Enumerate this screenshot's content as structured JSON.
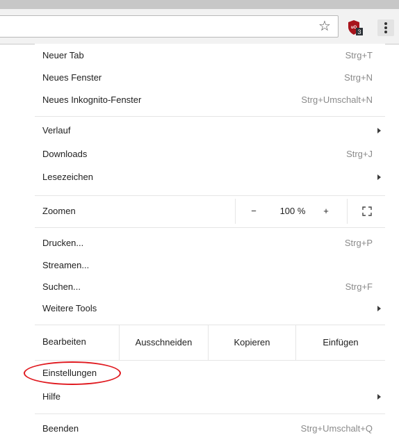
{
  "toolbar": {
    "bookmark_icon": "star-icon",
    "extension_icon": "ublock-origin-icon",
    "extension_badge": "3",
    "menu_icon": "kebab-menu-icon"
  },
  "menu": {
    "new_tab": {
      "label": "Neuer Tab",
      "shortcut": "Strg+T"
    },
    "new_window": {
      "label": "Neues Fenster",
      "shortcut": "Strg+N"
    },
    "incognito": {
      "label": "Neues Inkognito-Fenster",
      "shortcut": "Strg+Umschalt+N"
    },
    "history": {
      "label": "Verlauf"
    },
    "downloads": {
      "label": "Downloads",
      "shortcut": "Strg+J"
    },
    "bookmarks": {
      "label": "Lesezeichen"
    },
    "zoom": {
      "label": "Zoomen",
      "minus": "−",
      "value": "100 %",
      "plus": "+"
    },
    "print": {
      "label": "Drucken...",
      "shortcut": "Strg+P"
    },
    "cast": {
      "label": "Streamen..."
    },
    "find": {
      "label": "Suchen...",
      "shortcut": "Strg+F"
    },
    "more_tools": {
      "label": "Weitere Tools"
    },
    "edit": {
      "label": "Bearbeiten",
      "cut": "Ausschneiden",
      "copy": "Kopieren",
      "paste": "Einfügen"
    },
    "settings": {
      "label": "Einstellungen"
    },
    "help": {
      "label": "Hilfe"
    },
    "exit": {
      "label": "Beenden",
      "shortcut": "Strg+Umschalt+Q"
    }
  },
  "colors": {
    "highlight": "#e0191f",
    "shortcut_text": "#8a8a8a",
    "ublock_red": "#a8141c"
  }
}
